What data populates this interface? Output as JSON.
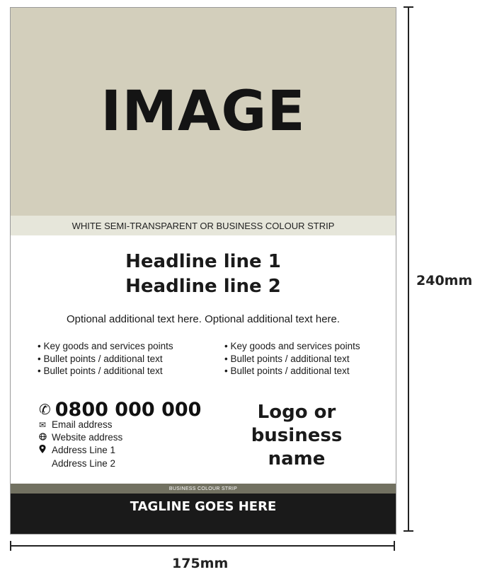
{
  "image_placeholder": "IMAGE",
  "strip_top": "WHITE SEMI-TRANSPARENT OR BUSINESS COLOUR STRIP",
  "headline": {
    "line1": "Headline line 1",
    "line2": "Headline line 2"
  },
  "optional_text": "Optional additional text here.  Optional additional text here.",
  "bullets_left": [
    "Key goods and services points",
    "Bullet points / additional text",
    "Bullet points / additional text"
  ],
  "bullets_right": [
    "Key goods and services points",
    "Bullet points / additional text",
    "Bullet points / additional text"
  ],
  "contact": {
    "phone": "0800 000 000",
    "email": "Email address",
    "website": "Website address",
    "address_line1": "Address Line 1",
    "address_line2": "Address Line 2"
  },
  "logo_text": "Logo or business name",
  "strip_bottom": "BUSINESS COLOUR STRIP",
  "tagline": "TAGLINE GOES HERE",
  "dimensions": {
    "height": "240mm",
    "width": "175mm"
  },
  "colors": {
    "image_bg": "#d3cfbc",
    "strip_top": "#e6e6da",
    "strip_bottom": "#727161",
    "tagline_bar": "#1a1a1a"
  },
  "icons": {
    "phone": "phone-icon",
    "email": "envelope-icon",
    "website": "globe-icon",
    "address": "map-pin-icon"
  }
}
